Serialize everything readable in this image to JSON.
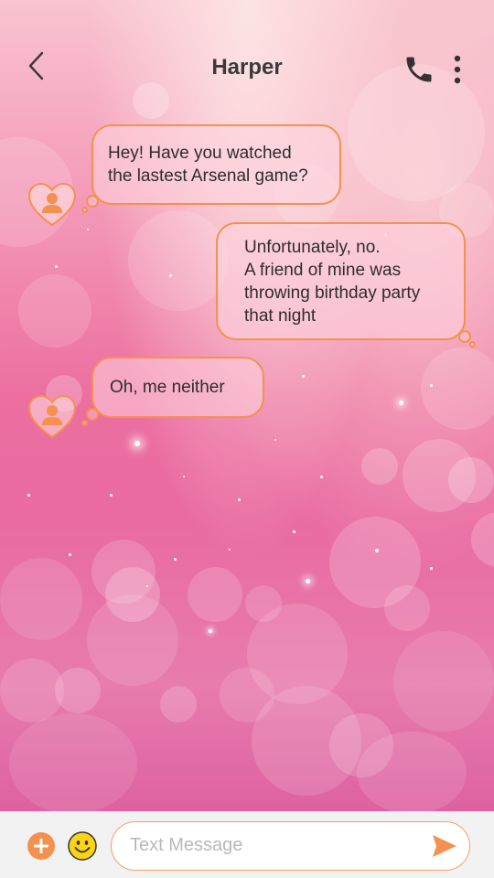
{
  "header": {
    "title": "Harper",
    "back_icon": "chevron-left-icon",
    "call_icon": "phone-icon",
    "more_icon": "more-vertical-icon"
  },
  "messages": [
    {
      "direction": "incoming",
      "text": "Hey! Have you watched\nthe lastest Arsenal game?"
    },
    {
      "direction": "outgoing",
      "text": "Unfortunately, no.\nA friend of mine was\nthrowing birthday party\nthat night"
    },
    {
      "direction": "incoming",
      "text": "Oh, me neither"
    }
  ],
  "composer": {
    "placeholder": "Text Message",
    "value": "",
    "add_icon": "plus-icon",
    "emoji_icon": "smiley-icon",
    "send_icon": "send-icon"
  },
  "colors": {
    "accent": "#f5914e",
    "title_text": "#3a3a3a",
    "bubble_border": "#f5914e",
    "background_top": "#f9c4d0",
    "background_bottom": "#d8539a"
  }
}
